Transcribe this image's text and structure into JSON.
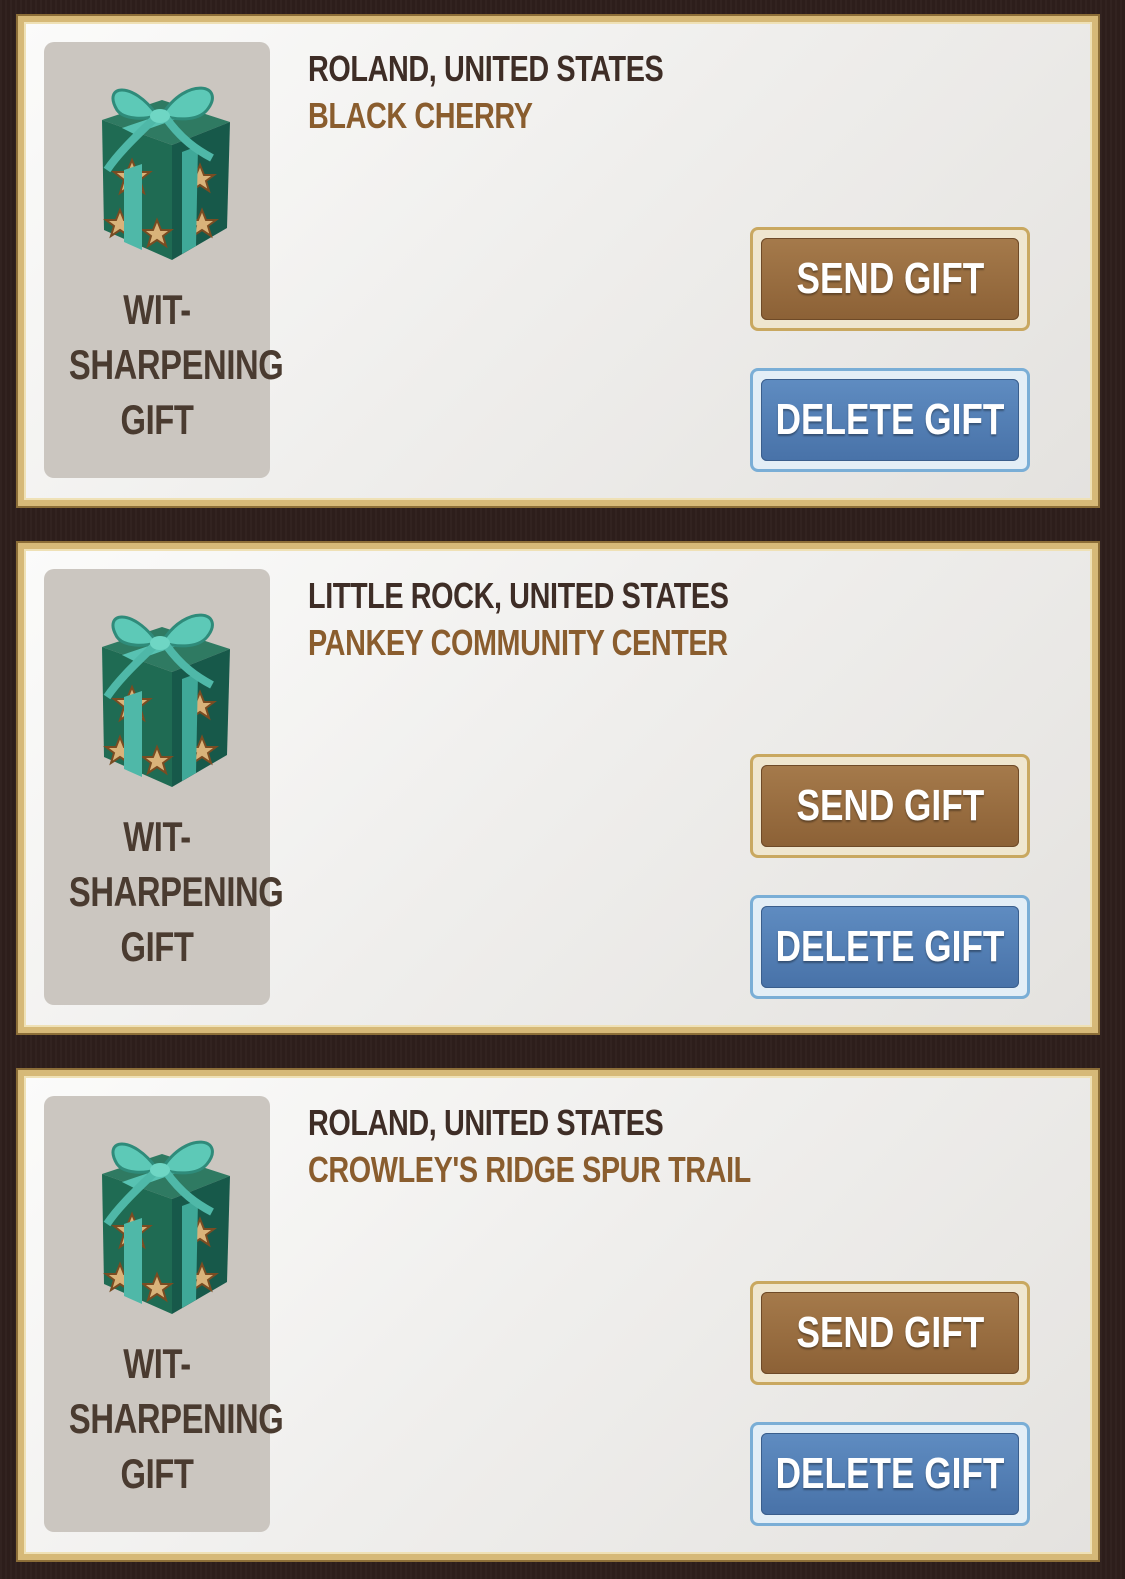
{
  "colors": {
    "background": "#2e1f1c",
    "card_border": "#d6b978",
    "send_button": "#9b6f42",
    "delete_button": "#5580b8",
    "location_text": "#3e2d26",
    "poi_text": "#8a5d2e"
  },
  "gifts": [
    {
      "icon": "gift-box-icon",
      "item_name": "WIT-\nSHARPENING\nGIFT",
      "sender_location": "ROLAND, UNITED STATES",
      "poi_name": "BLACK CHERRY",
      "send_label": "SEND GIFT",
      "delete_label": "DELETE GIFT"
    },
    {
      "icon": "gift-box-icon",
      "item_name": "WIT-\nSHARPENING\nGIFT",
      "sender_location": "LITTLE ROCK, UNITED STATES",
      "poi_name": "PANKEY COMMUNITY CENTER",
      "send_label": "SEND GIFT",
      "delete_label": "DELETE GIFT"
    },
    {
      "icon": "gift-box-icon",
      "item_name": "WIT-\nSHARPENING\nGIFT",
      "sender_location": "ROLAND, UNITED STATES",
      "poi_name": "CROWLEY'S RIDGE SPUR TRAIL",
      "send_label": "SEND GIFT",
      "delete_label": "DELETE GIFT"
    }
  ]
}
